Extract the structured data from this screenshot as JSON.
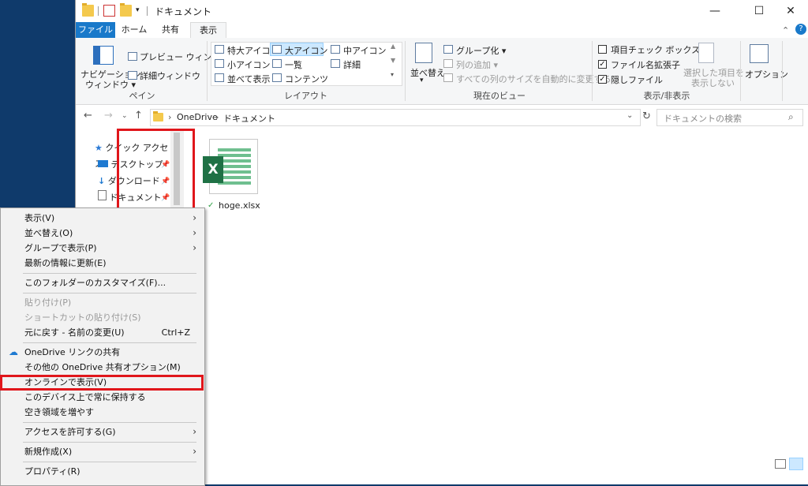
{
  "title": "ドキュメント",
  "window_buttons": {
    "minimize": "—",
    "maximize": "☐",
    "close": "✕"
  },
  "tabs": {
    "file": "ファイル",
    "home": "ホーム",
    "share": "共有",
    "view": "表示",
    "help": "?"
  },
  "ribbon": {
    "pane": {
      "nav_pane_line1": "ナビゲーション",
      "nav_pane_line2": "ウィンドウ",
      "preview": "プレビュー ウィンドウ",
      "details": "詳細ウィンドウ",
      "label": "ペイン"
    },
    "layout": {
      "xl": "特大アイコン",
      "large": "大アイコン",
      "medium": "中アイコン",
      "small": "小アイコン",
      "list": "一覧",
      "details": "詳細",
      "tiles": "並べて表示",
      "content": "コンテンツ",
      "label": "レイアウト"
    },
    "current_view": {
      "sort": "並べ替え",
      "group": "グループ化",
      "add_column": "列の追加",
      "fit_columns": "すべての列のサイズを自動的に変更する",
      "label": "現在のビュー"
    },
    "show_hide": {
      "item_checkbox": "項目チェック ボックス",
      "extensions": "ファイル名拡張子",
      "hidden": "隠しファイル",
      "hide_sel_line1": "選択した項目を",
      "hide_sel_line2": "表示しない",
      "label": "表示/非表示"
    },
    "options": "オプション"
  },
  "address": {
    "path1": "OneDrive",
    "path2": "ドキュメント",
    "search_placeholder": "ドキュメントの検索"
  },
  "nav": {
    "quick": "クイック アクセス",
    "desktop": "デスクトップ",
    "download": "ダウンロード",
    "documents": "ドキュメント"
  },
  "file": {
    "name": "hoge.xlsx",
    "icon_letter": "X"
  },
  "menu": {
    "view": "表示(V)",
    "sort": "並べ替え(O)",
    "group": "グループで表示(P)",
    "refresh": "最新の情報に更新(E)",
    "customize": "このフォルダーのカスタマイズ(F)...",
    "paste": "貼り付け(P)",
    "paste_shortcut": "ショートカットの貼り付け(S)",
    "undo": "元に戻す - 名前の変更(U)",
    "undo_shortcut": "Ctrl+Z",
    "onedrive_share": "OneDrive リンクの共有",
    "onedrive_more": "その他の OneDrive 共有オプション(M)",
    "view_online": "オンラインで表示(V)",
    "keep_device": "このデバイス上で常に保持する",
    "free_space": "空き領域を増やす",
    "give_access": "アクセスを許可する(G)",
    "new": "新規作成(X)",
    "properties": "プロパティ(R)"
  },
  "colors": {
    "accent": "#1979ca",
    "highlight": "#e0161b",
    "excel": "#1f7145"
  }
}
